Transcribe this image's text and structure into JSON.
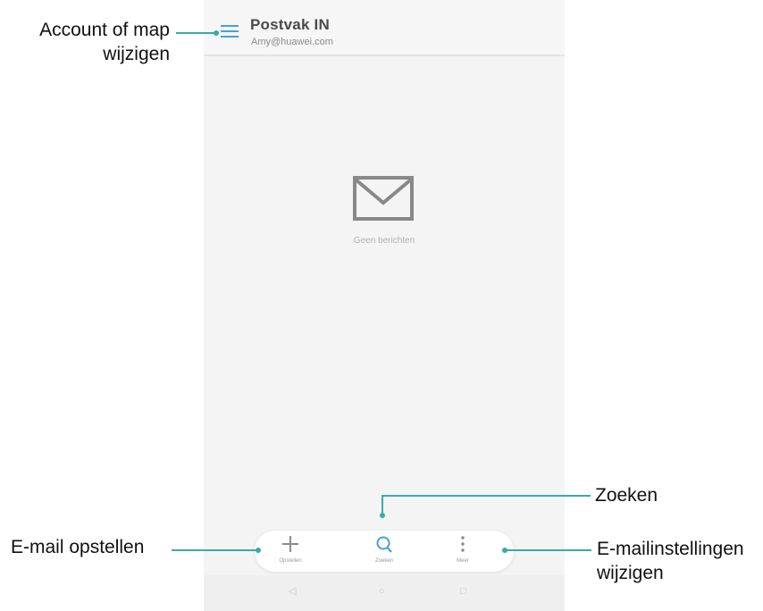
{
  "app": {
    "title": "Postvak IN",
    "account": "Amy@huawei.com",
    "empty_text": "Geen berichten",
    "empty_icon": "envelope-icon",
    "menu_icon": "hamburger-menu-icon"
  },
  "bottom_bar": [
    {
      "label": "Opstellen",
      "icon": "plus-icon"
    },
    {
      "label": "Zoeken",
      "icon": "search-icon"
    },
    {
      "label": "Meer",
      "icon": "more-vertical-icon"
    }
  ],
  "system_nav": {
    "back": "◁",
    "home": "○",
    "recents": "□"
  },
  "callouts": {
    "menu_line1": "Account of map",
    "menu_line2": "wijzigen",
    "compose": "E-mail opstellen",
    "search": "Zoeken",
    "settings_line1": "E-mailinstellingen",
    "settings_line2": "wijzigen"
  },
  "colors": {
    "accent": "#3aa9aa",
    "menu_icon": "#4a9fd6",
    "icon_gray": "#8a8a8a"
  }
}
